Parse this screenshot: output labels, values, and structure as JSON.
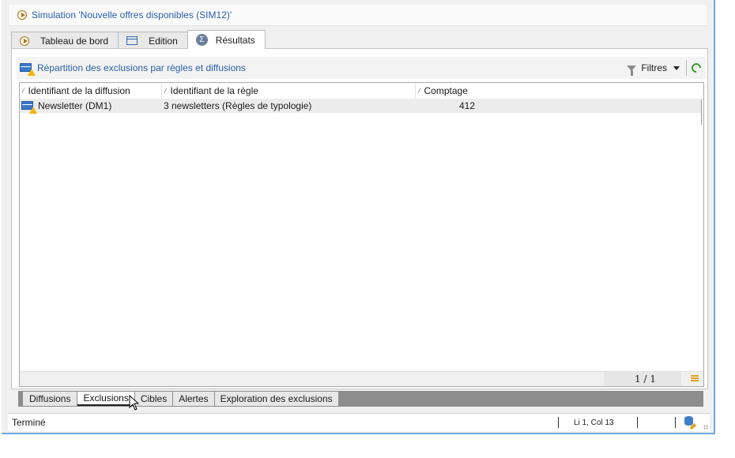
{
  "window": {
    "title": "Simulation 'Nouvelle offres disponibles (SIM12)'"
  },
  "tabs": [
    {
      "label": "Tableau de bord",
      "icon": "play-circle-icon"
    },
    {
      "label": "Edition",
      "icon": "form-window-icon"
    },
    {
      "label": "Résultats",
      "icon": "sigma-icon",
      "active": true
    }
  ],
  "toolbar": {
    "title": "Répartition des exclusions par règles et diffusions",
    "filters_label": "Filtres"
  },
  "grid": {
    "columns": [
      "Identifiant de la diffusion",
      "Identifiant de la règle",
      "Comptage"
    ],
    "rows": [
      {
        "delivery": "Newsletter (DM1)",
        "rule": "3 newsletters (Règles de typologie)",
        "count": "412"
      }
    ],
    "pager": "1 / 1"
  },
  "bottom_tabs": [
    {
      "label": "Diffusions"
    },
    {
      "label": "Exclusions",
      "active": true
    },
    {
      "label": "Cibles"
    },
    {
      "label": "Alertes"
    },
    {
      "label": "Exploration des exclusions"
    }
  ],
  "status": {
    "text": "Terminé",
    "position": "Li 1, Col 13"
  },
  "colors": {
    "accent": "#2b5fa8",
    "window_border": "#6ea8dc",
    "refresh": "#3c9a2e"
  }
}
